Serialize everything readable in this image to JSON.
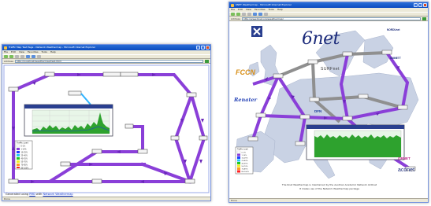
{
  "window_left": {
    "title": "Traffic Map Test Page - Network Weathermap - Microsoft Internet Explorer",
    "menu": [
      "File",
      "Edit",
      "View",
      "Favorites",
      "Tools",
      "Help"
    ],
    "address_label": "Address",
    "address": "http://localhost/weathermap/test.html",
    "status": "Done",
    "footer_prefix": "Generated using ",
    "footer_link1": "RRD",
    "footer_mid": " with ",
    "footer_link2": "Network Weathermap",
    "legend_title": "Traffic Load",
    "legend_rows": [
      "0-1%",
      "1-10%",
      "10-25%",
      "25-40%",
      "40-55%",
      "55-70%",
      "70-85%",
      "85-100%"
    ]
  },
  "window_right": {
    "title": "6NET Weathermap - Microsoft Internet Explorer",
    "menu": [
      "File",
      "Edit",
      "View",
      "Favorites",
      "Tools",
      "Help"
    ],
    "address_label": "Address",
    "address": "http://www.6net.org/weathermap/",
    "status": "Done",
    "logo_main": "6net",
    "logo_fccn": "FCCN",
    "logo_renater": "Renater",
    "logo_surf": "SURFnet",
    "logo_dfn": "DFN",
    "logo_grnet": "GRNET",
    "logo_acone": "aconet",
    "logo_nordu": "NORDUnet",
    "logo_uninett": "UNINETT",
    "legend_title": "Traffic Load",
    "legend_rows": [
      "0-1%",
      "1-10%",
      "10-25%",
      "25-40%",
      "40-55%",
      "55-70%",
      "70-85%",
      "85-100%"
    ],
    "credit_line1": "The 6net Weathermap is maintained by the Austrian Academic Network ACOnet",
    "credit_line2": "It makes use of the Network Weathermap package"
  },
  "colors": {
    "link": "#8a3fd8",
    "link_dark": "#6a28b8",
    "grey_link": "#8f8f8f",
    "graph_fill": "#2ea22e",
    "graph_bg": "#d8f0d8",
    "node_border": "#555555"
  }
}
